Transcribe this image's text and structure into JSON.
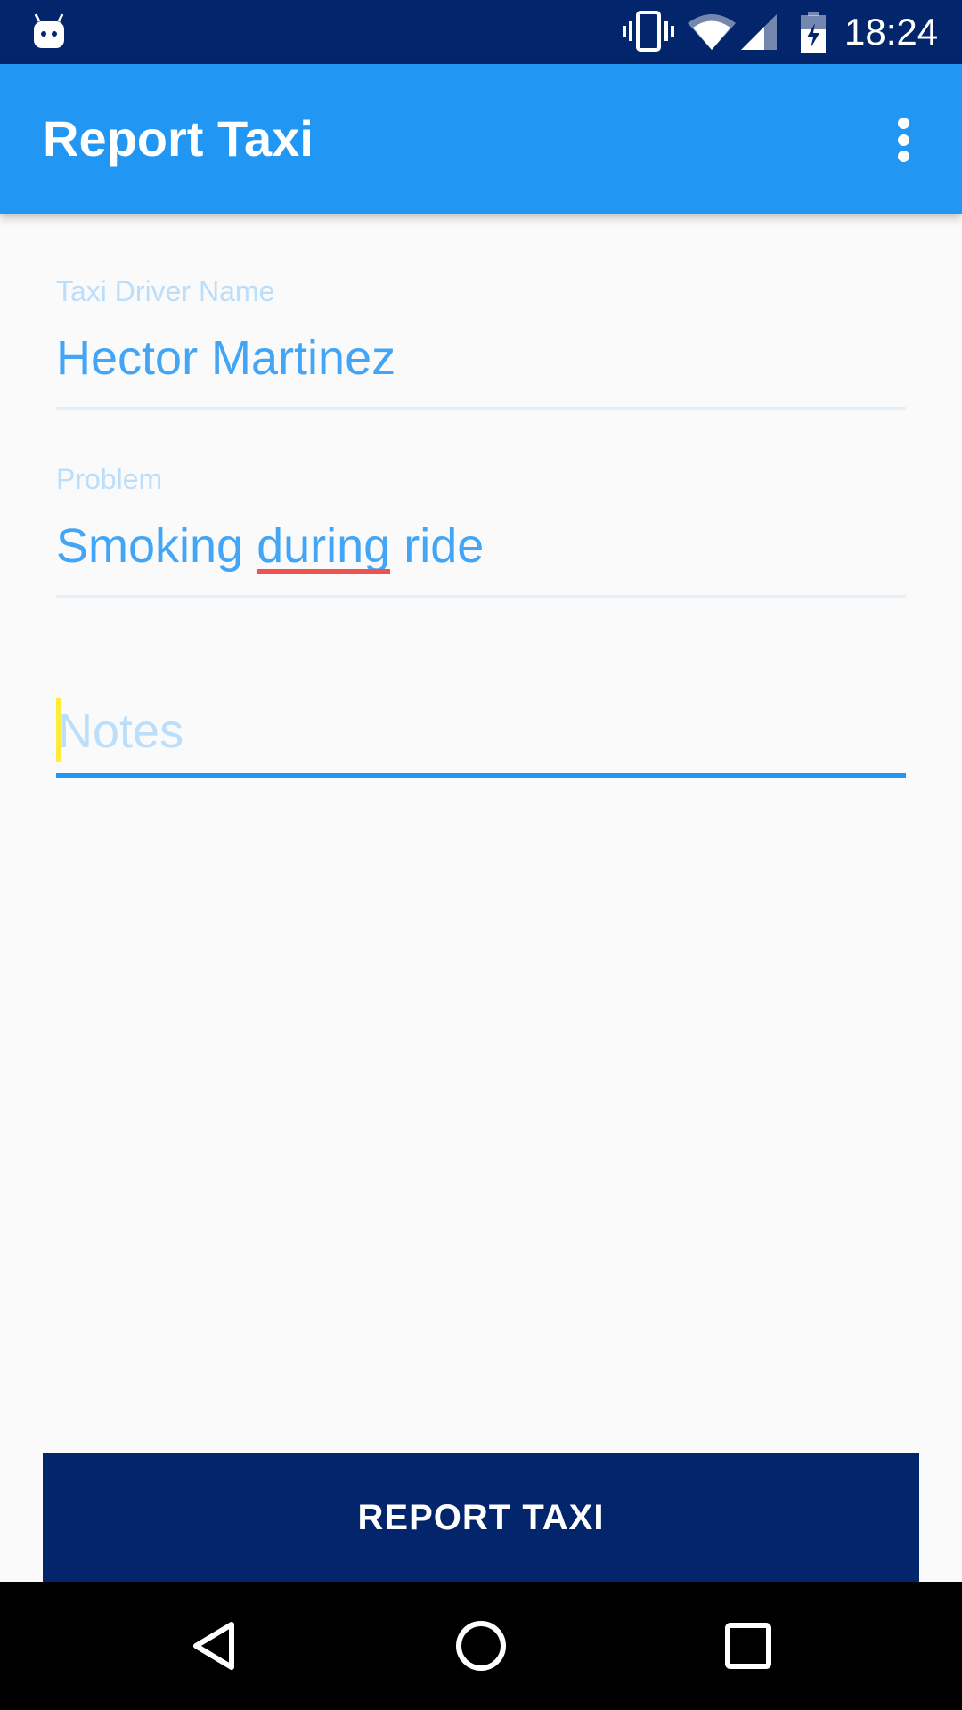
{
  "status_bar": {
    "time": "18:24",
    "icons": [
      "android-notification-icon",
      "vibrate-icon",
      "wifi-icon",
      "cell-signal-icon",
      "battery-charging-icon"
    ]
  },
  "app_bar": {
    "title": "Report Taxi",
    "menu_icon": "more-vert-icon"
  },
  "form": {
    "driver_name": {
      "label": "Taxi Driver Name",
      "value": "Hector Martinez"
    },
    "problem": {
      "label": "Problem",
      "value_before": "Smoking ",
      "value_misspelled": "during",
      "value_after": " ride"
    },
    "notes": {
      "placeholder": "Notes",
      "value": ""
    }
  },
  "actions": {
    "report_label": "REPORT TAXI"
  },
  "nav_bar": {
    "icons": [
      "back-icon",
      "home-icon",
      "recents-icon"
    ]
  },
  "colors": {
    "status_bar": "#03256c",
    "app_bar": "#2196f3",
    "accent": "#2196f3",
    "text_value": "#42a5f5",
    "label_hint": "#bbdefb",
    "button_bg": "#03256c",
    "spellcheck": "#ef5350",
    "cursor": "#ffeb3b"
  }
}
